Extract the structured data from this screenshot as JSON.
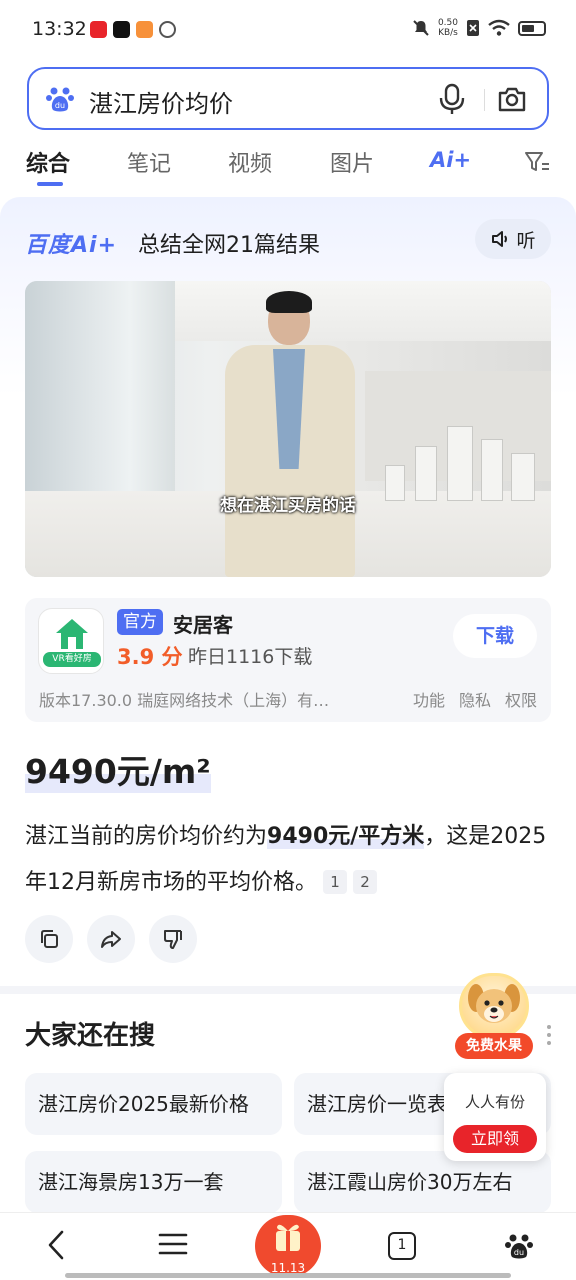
{
  "status_bar": {
    "time": "13:32",
    "net_speed_value": "0.50",
    "net_speed_unit": "KB/s"
  },
  "search": {
    "query": "湛江房价均价"
  },
  "tabs": [
    {
      "label": "综合",
      "active": true
    },
    {
      "label": "笔记",
      "active": false
    },
    {
      "label": "视频",
      "active": false
    },
    {
      "label": "图片",
      "active": false
    }
  ],
  "tab_ai_label": "Ai+",
  "ai_card": {
    "logo": "百度Ai+",
    "summary": "总结全网21篇结果",
    "listen_label": "听",
    "video_caption": "想在湛江买房的话",
    "app": {
      "icon_band": "VR看好房",
      "official_badge": "官方",
      "name": "安居客",
      "rating": "3.9 分",
      "downloads": "昨日1116下载",
      "download_button": "下载",
      "meta": "版本17.30.0  瑞庭网络技术（上海）有…",
      "links": [
        "功能",
        "隐私",
        "权限"
      ]
    },
    "price_headline": "9490元/m²",
    "answer_prefix": "湛江当前的房价均价约为",
    "answer_bold": "9490元/平方米",
    "answer_suffix": "，这是2025年12月新房市场的平均价格。",
    "citations": [
      "1",
      "2"
    ]
  },
  "related": {
    "title": "大家还在搜",
    "items": [
      "湛江房价2025最新价格",
      "湛江房价一览表",
      "湛江海景房13万一套",
      "湛江霞山房价30万左右"
    ]
  },
  "promo": {
    "tag": "免费水果",
    "text": "人人有份",
    "button": "立即领"
  },
  "bottom_nav": {
    "center_count": "11.13",
    "tabs_count": "1"
  },
  "colors": {
    "accent": "#4e6ef2",
    "rating": "#f25d29",
    "promo_red": "#e8242a"
  }
}
